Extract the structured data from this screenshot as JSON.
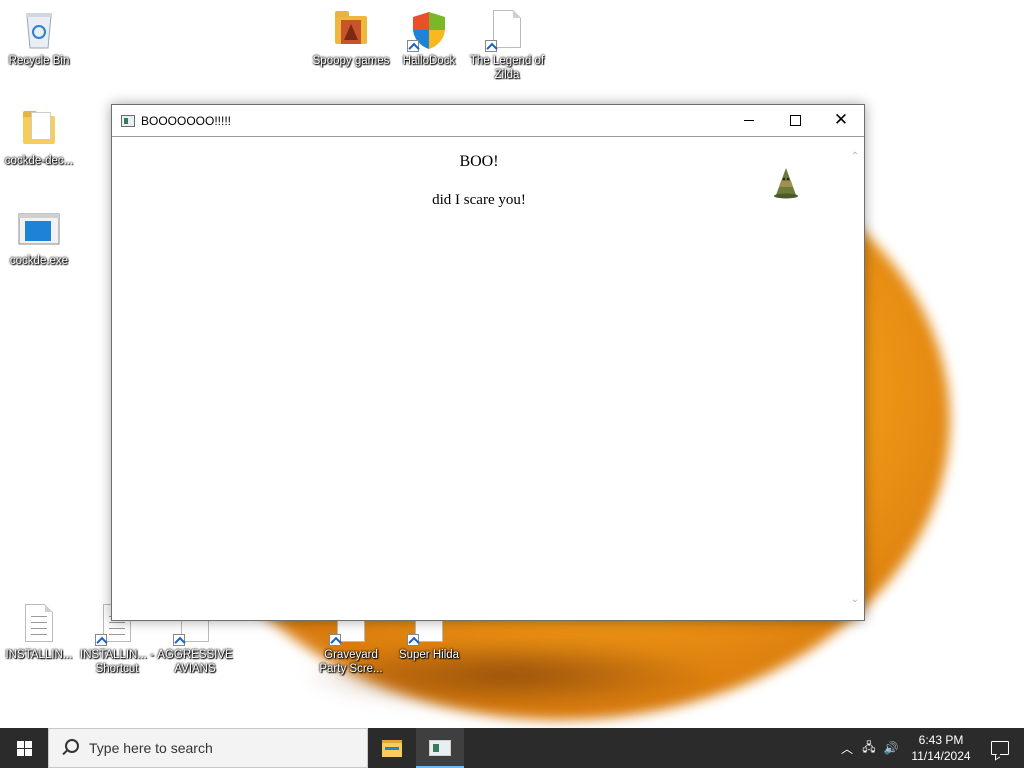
{
  "desktop": {
    "icons": [
      {
        "id": "recycle-bin",
        "label": "Recycle Bin"
      },
      {
        "id": "spoopy-games",
        "label": "Spoopy games"
      },
      {
        "id": "hallodock",
        "label": "HalloDock"
      },
      {
        "id": "legend-zilda",
        "label": "The Legend of Zilda"
      },
      {
        "id": "cockde-dec",
        "label": "cockde-dec..."
      },
      {
        "id": "cockde-exe",
        "label": "cockde.exe"
      },
      {
        "id": "installin-1",
        "label": "INSTALLIN..."
      },
      {
        "id": "installin-shortcut",
        "label": "INSTALLIN... - Shortcut"
      },
      {
        "id": "aggressive-avians",
        "label": "AGGRESSIVE AVIANS"
      },
      {
        "id": "graveyard-party",
        "label": "Graveyard Party Scre..."
      },
      {
        "id": "super-hilda",
        "label": "Super Hilda"
      }
    ]
  },
  "window": {
    "title": "BOOOOOOO!!!!!",
    "heading": "BOO!",
    "message": "did I scare you!",
    "buttons": {
      "minimize": "minimize",
      "maximize": "maximize",
      "close": "close"
    }
  },
  "taskbar": {
    "search_placeholder": "Type here to search",
    "clock_time": "6:43 PM",
    "clock_date": "11/14/2024"
  }
}
